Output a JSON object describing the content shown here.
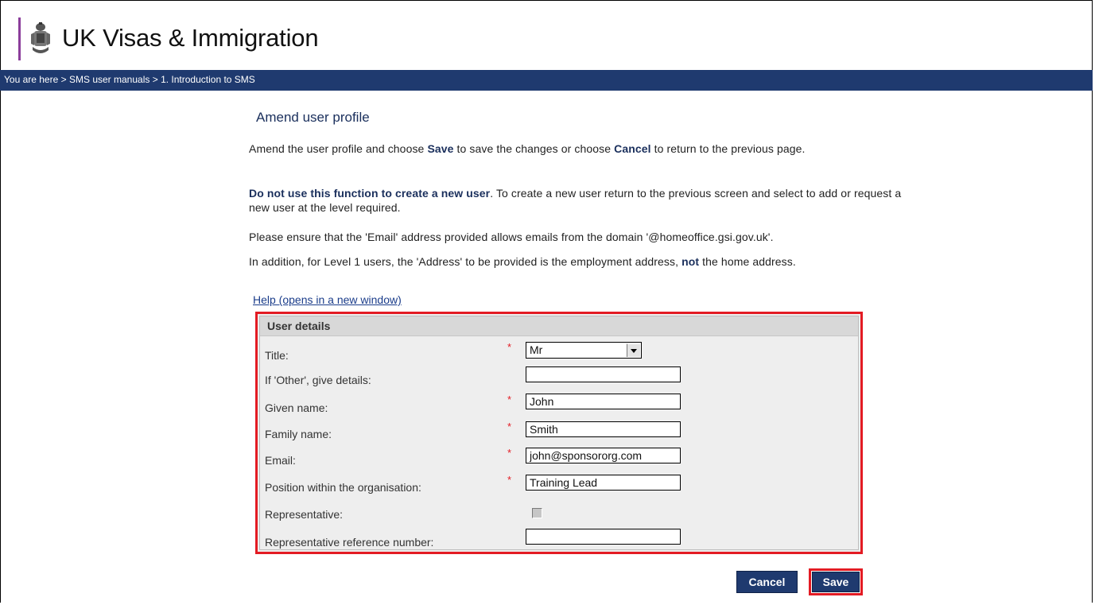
{
  "header": {
    "brand_name": "UK Visas & Immigration",
    "brand_accent_color": "#8b3d9b",
    "logo_icon": "royal-crest-icon"
  },
  "breadcrumb": {
    "prefix": "You are here",
    "separator": ">",
    "items": [
      "SMS user manuals",
      "1. Introduction to SMS"
    ],
    "bar_color": "#1f3a6f"
  },
  "page": {
    "title": "Amend user profile",
    "intro": {
      "part1": "Amend the user profile and choose ",
      "save_word": "Save",
      "part2": " to save the changes or choose ",
      "cancel_word": "Cancel",
      "part3": " to return to the previous page."
    },
    "warning": {
      "bold": "Do not use this function to create a new user",
      "rest": ". To create a new user return to the previous screen and select to add or request a new user at the level required."
    },
    "email_note": "Please ensure that the 'Email' address provided allows emails from the domain '@homeoffice.gsi.gov.uk'.",
    "address_note": {
      "part1": "In addition, for Level 1 users, the 'Address' to be provided is the employment address, ",
      "bold": "not",
      "part2": " the home address."
    },
    "help_link": "Help (opens in a new window)"
  },
  "form": {
    "section_title": "User details",
    "required_marker": "*",
    "fields": {
      "title": {
        "label": "Title:",
        "value": "Mr"
      },
      "other": {
        "label": "If 'Other', give details:",
        "value": ""
      },
      "given_name": {
        "label": "Given name:",
        "value": "John"
      },
      "family_name": {
        "label": "Family name:",
        "value": "Smith"
      },
      "email": {
        "label": "Email:",
        "value": "john@sponsororg.com"
      },
      "position": {
        "label": "Position within the organisation:",
        "value": "Training Lead"
      },
      "representative": {
        "label": "Representative:",
        "checked": false
      },
      "rep_ref": {
        "label": "Representative reference number:",
        "value": ""
      }
    },
    "highlight_color": "#e31b23"
  },
  "buttons": {
    "cancel": "Cancel",
    "save": "Save"
  }
}
